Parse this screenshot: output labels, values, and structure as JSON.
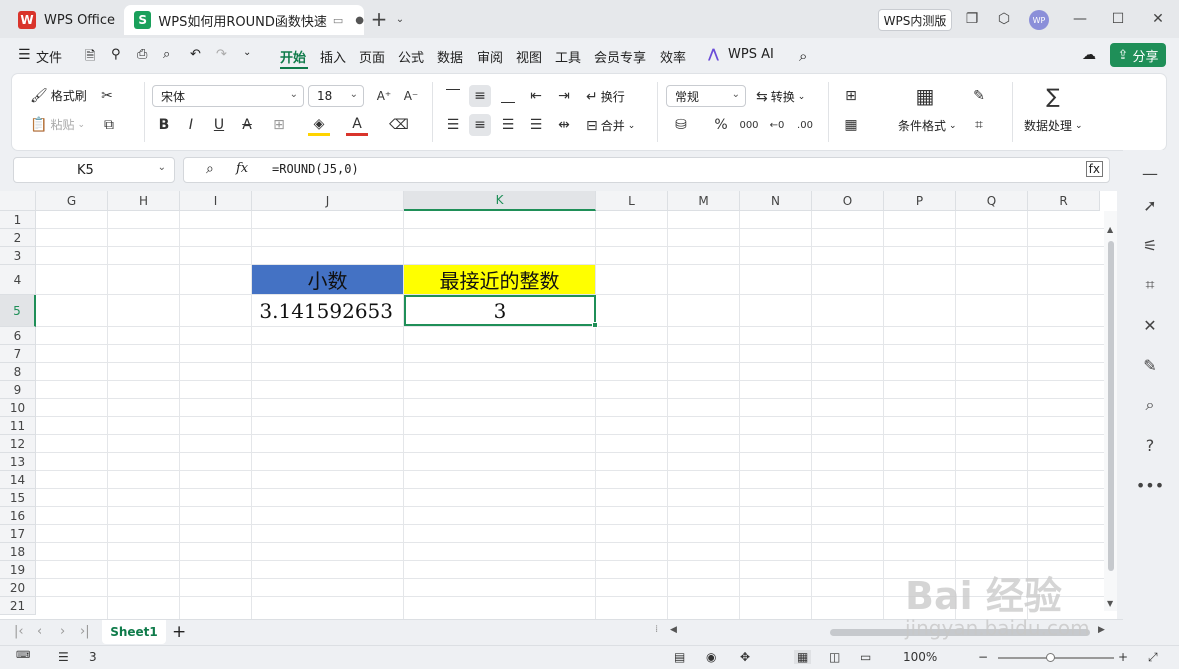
{
  "titlebar": {
    "home_tab": "WPS Office",
    "doc_tab": "WPS如何用ROUND函数快速",
    "beta_label": "WPS内测版",
    "avatar_text": "WP"
  },
  "menu": {
    "file": "文件",
    "items": [
      "开始",
      "插入",
      "页面",
      "公式",
      "数据",
      "审阅",
      "视图",
      "工具",
      "会员专享",
      "效率"
    ],
    "wps_ai": "WPS AI",
    "share": "分享"
  },
  "ribbon": {
    "format_painter": "格式刷",
    "paste": "粘贴",
    "font_name": "宋体",
    "font_size": "18",
    "wrap": "换行",
    "merge": "合并",
    "number_format": "常规",
    "convert": "转换",
    "conditional_format": "条件格式",
    "data_process": "数据处理"
  },
  "formula_bar": {
    "name_box": "K5",
    "fx": "fx",
    "formula": "=ROUND(J5,0)"
  },
  "grid": {
    "columns": [
      "G",
      "H",
      "I",
      "J",
      "K",
      "L",
      "M",
      "N",
      "O",
      "P",
      "Q",
      "R"
    ],
    "rows": [
      "1",
      "2",
      "3",
      "4",
      "5",
      "6",
      "7",
      "8",
      "9",
      "10",
      "11",
      "12",
      "13",
      "14",
      "15",
      "16",
      "17",
      "18",
      "19",
      "20",
      "21"
    ],
    "cells": {
      "J4": "小数",
      "K4": "最接近的整数",
      "J5": "3.141592653",
      "K5": "3"
    },
    "colors": {
      "J4_fill": "#4472c4",
      "K4_fill": "#ffff00",
      "selection": "#1f8f58"
    }
  },
  "sheets": {
    "active": "Sheet1",
    "add": "+"
  },
  "status": {
    "selected_value": "3",
    "zoom": "100%"
  },
  "watermark": {
    "line1": "Bai 经验",
    "line2": "jingyan.baidu.com"
  }
}
